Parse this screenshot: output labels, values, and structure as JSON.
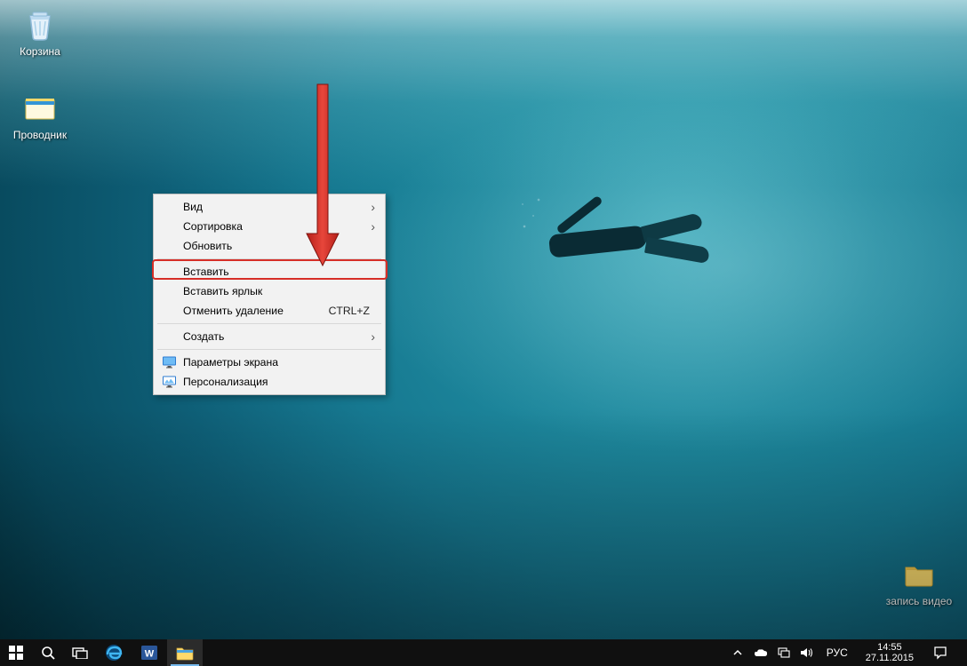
{
  "desktop_icons": {
    "recycle_bin": "Корзина",
    "explorer": "Проводник",
    "folder": "запись видео"
  },
  "context_menu": {
    "view": "Вид",
    "sort": "Сортировка",
    "refresh": "Обновить",
    "paste": "Вставить",
    "paste_shortcut": "Вставить ярлык",
    "undo_delete": "Отменить удаление",
    "undo_delete_key": "CTRL+Z",
    "create": "Создать",
    "display_settings": "Параметры экрана",
    "personalize": "Персонализация"
  },
  "tray": {
    "lang": "РУС",
    "time": "14:55",
    "date": "27.11.2015"
  }
}
